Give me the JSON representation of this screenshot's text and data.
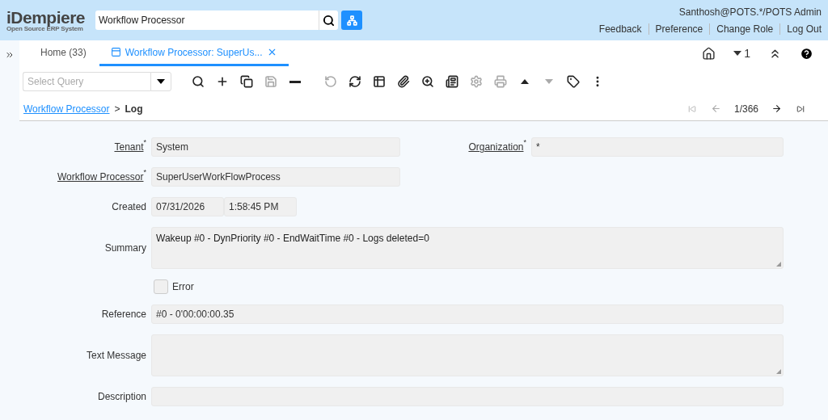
{
  "header": {
    "logo": "iDempiere",
    "logo_tagline": "Open Source ERP System",
    "search": {
      "value": "Workflow Processor"
    },
    "user": "Santhosh@POTS.*/POTS Admin",
    "links": [
      "Feedback",
      "Preference",
      "Change Role",
      "Log Out"
    ]
  },
  "tabs": [
    {
      "label": "Home (33)",
      "selected": false,
      "closable": false
    },
    {
      "label": "Workflow Processor: SuperUs...",
      "selected": true,
      "closable": true
    }
  ],
  "tab_bar_right": {
    "count": "1"
  },
  "toolbar": {
    "query": {
      "placeholder": "Select Query"
    },
    "buttons": [
      {
        "disabled": false
      },
      {
        "disabled": false
      },
      {
        "disabled": false
      },
      {
        "disabled": true
      },
      {
        "disabled": false
      },
      {
        "disabled": true
      },
      {
        "disabled": false
      },
      {
        "disabled": false
      },
      {
        "disabled": false
      },
      {
        "disabled": false
      },
      {
        "disabled": false
      },
      {
        "disabled": true
      },
      {
        "disabled": true
      },
      {
        "disabled": false
      },
      {
        "disabled": true
      },
      {
        "disabled": false
      },
      {
        "disabled": false
      }
    ]
  },
  "breadcrumb": {
    "parent": "Workflow Processor",
    "separator": ">",
    "current": "Log"
  },
  "navigation": {
    "record": "1/366",
    "first_disabled": true,
    "previous_disabled": true,
    "next_disabled": false,
    "last_disabled": false
  },
  "form": {
    "rows": [
      {
        "kind": "pair",
        "fields": [
          {
            "label": "Tenant",
            "link": true,
            "required": "*",
            "value": "System"
          },
          {
            "label": "Organization",
            "link": true,
            "required": "*",
            "value": "*"
          }
        ]
      },
      {
        "kind": "single",
        "field": {
          "label": "Workflow Processor",
          "link": true,
          "required": "*",
          "value": "SuperUserWorkFlowProcess"
        }
      },
      {
        "kind": "datetime",
        "label": "Created",
        "date": "07/31/2026",
        "time": "1:58:45 PM"
      },
      {
        "kind": "textarea",
        "label": "Summary",
        "value": "Wakeup #0 - DynPriority #0 - EndWaitTime #0 - Logs deleted=0"
      },
      {
        "kind": "checkbox",
        "label": "Error",
        "checked": false
      },
      {
        "kind": "wide",
        "label": "Reference",
        "value": "#0 - 0'00:00:00.35"
      },
      {
        "kind": "textarea",
        "label": "Text Message",
        "value": ""
      },
      {
        "kind": "wide",
        "label": "Description",
        "value": ""
      }
    ]
  }
}
